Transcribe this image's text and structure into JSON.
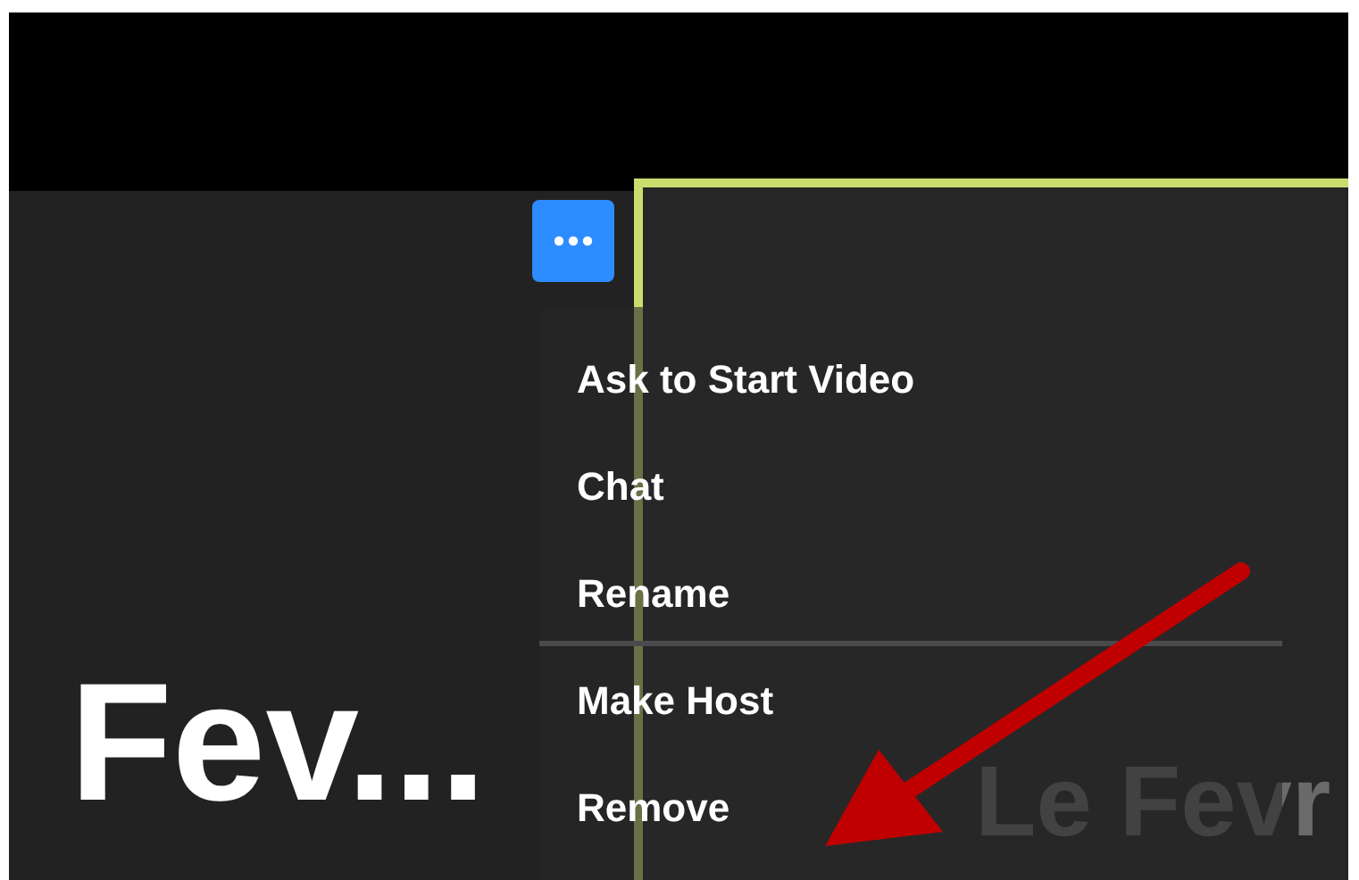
{
  "tiles": [
    {
      "name": "Fev...",
      "active": false
    },
    {
      "name": "Le Fevr",
      "active": true
    }
  ],
  "more_button": {
    "selected": true
  },
  "menu": {
    "groups": [
      [
        "Ask to Start Video",
        "Chat",
        "Rename"
      ],
      [
        "Make Host",
        "Remove"
      ]
    ]
  }
}
